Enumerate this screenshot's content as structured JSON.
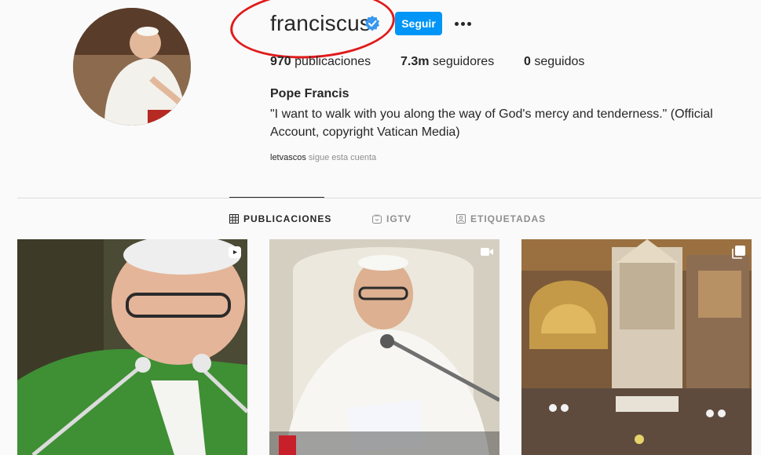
{
  "profile": {
    "username": "franciscus",
    "follow_label": "Seguir",
    "posts_count": "970",
    "posts_label": "publicaciones",
    "followers_count": "7.3m",
    "followers_label": "seguidores",
    "following_count": "0",
    "following_label": "seguidos",
    "full_name": "Pope Francis",
    "bio": "\"I want to walk with you along the way of God's mercy and tenderness.\" (Official Account, copyright Vatican Media)",
    "followed_by_user": "letvascos",
    "followed_by_text": "sigue esta cuenta"
  },
  "tabs": [
    {
      "label": "PUBLICACIONES",
      "icon": "grid-icon",
      "active": true
    },
    {
      "label": "IGTV",
      "icon": "igtv-icon",
      "active": false
    },
    {
      "label": "ETIQUETADAS",
      "icon": "tagged-icon",
      "active": false
    }
  ],
  "posts": [
    {
      "badge": "reel-icon"
    },
    {
      "badge": "video-icon"
    },
    {
      "badge": "carousel-icon"
    }
  ],
  "colors": {
    "accent": "#0095f6",
    "annotation": "#e01b1b",
    "verified": "#3897f0"
  }
}
